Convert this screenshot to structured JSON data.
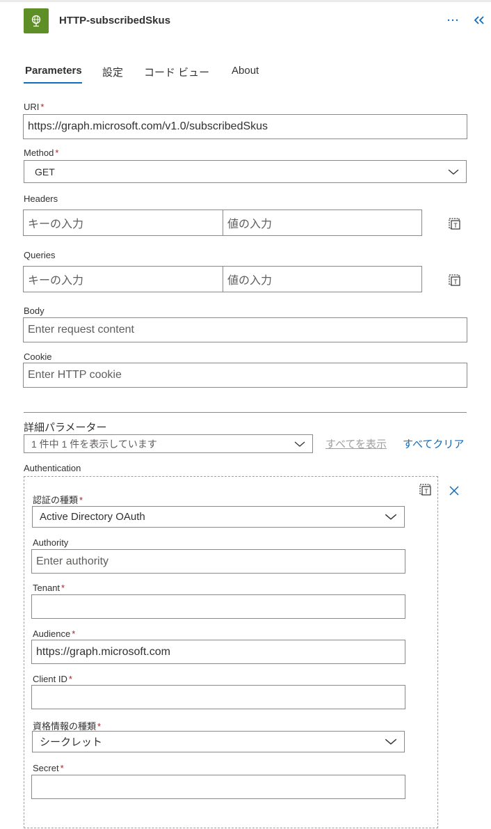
{
  "header": {
    "title": "HTTP-subscribedSkus",
    "more_label": "···"
  },
  "tabs": [
    {
      "label": "Parameters",
      "active": true
    },
    {
      "label": "設定"
    },
    {
      "label": "コード ビュー"
    },
    {
      "label": "About"
    }
  ],
  "form": {
    "uri": {
      "label": "URI",
      "required": "*",
      "value": "https://graph.microsoft.com/v1.0/subscribedSkus"
    },
    "method": {
      "label": "Method",
      "required": "*",
      "value": "GET"
    },
    "headers": {
      "label": "Headers",
      "key_placeholder": "キーの入力",
      "value_placeholder": "値の入力"
    },
    "queries": {
      "label": "Queries",
      "key_placeholder": "キーの入力",
      "value_placeholder": "値の入力"
    },
    "body": {
      "label": "Body",
      "placeholder": "Enter request content"
    },
    "cookie": {
      "label": "Cookie",
      "placeholder": "Enter HTTP cookie"
    }
  },
  "advanced": {
    "label": "詳細パラメーター",
    "summary": "1 件中 1 件を表示しています",
    "show_all": "すべてを表示",
    "clear_all": "すべてクリア"
  },
  "auth": {
    "label": "Authentication",
    "type": {
      "label": "認証の種類",
      "required": "*",
      "value": "Active Directory OAuth"
    },
    "authority": {
      "label": "Authority",
      "placeholder": "Enter authority"
    },
    "tenant": {
      "label": "Tenant",
      "required": "*",
      "value": ""
    },
    "audience": {
      "label": "Audience",
      "required": "*",
      "value": "https://graph.microsoft.com"
    },
    "client_id": {
      "label": "Client ID",
      "required": "*",
      "value": ""
    },
    "credential_type": {
      "label": "資格情報の種類",
      "required": "*",
      "value": "シークレット"
    },
    "secret": {
      "label": "Secret",
      "required": "*",
      "value": ""
    }
  },
  "colors": {
    "accent": "#0f6cbd",
    "app_icon": "#5e8f27",
    "required": "#a4262c"
  },
  "icons": {
    "app": "globe-icon",
    "more": "more-icon",
    "collapse": "double-chevron-left-icon",
    "switch_mode": "text-mode-icon",
    "close": "close-icon",
    "chevron": "chevron-down-icon"
  }
}
